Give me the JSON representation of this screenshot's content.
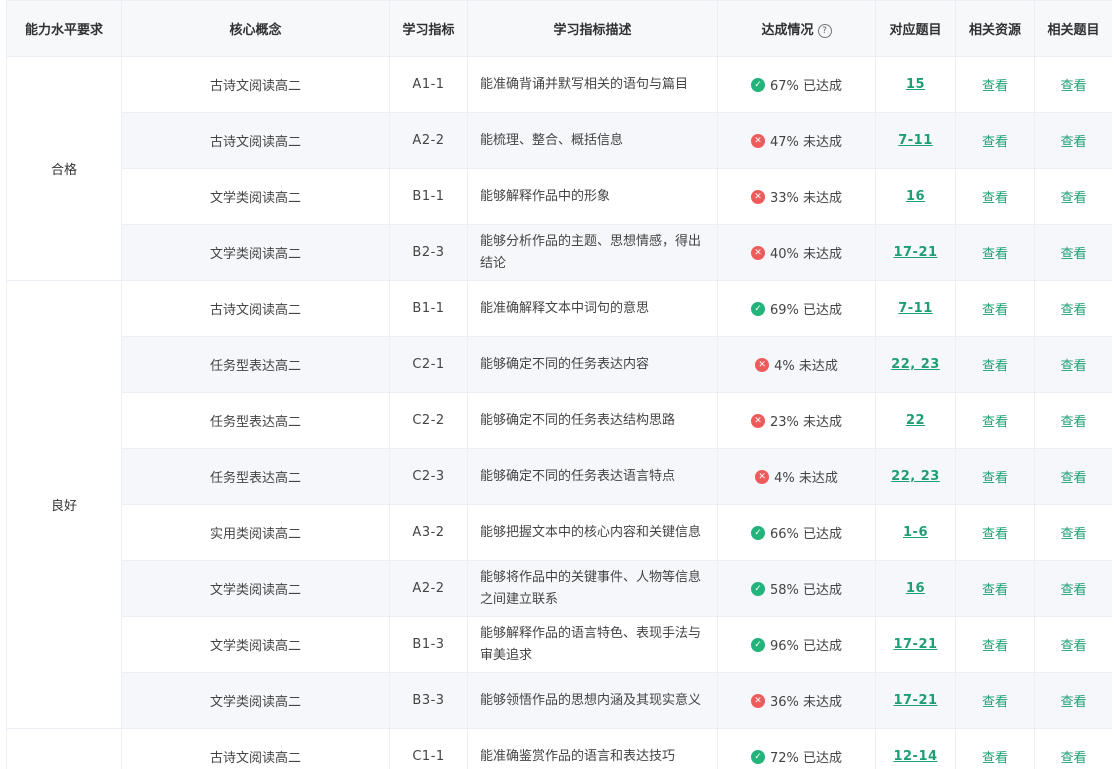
{
  "headers": {
    "level": "能力水平要求",
    "concept": "核心概念",
    "code": "学习指标",
    "desc": "学习指标描述",
    "status": "达成情况",
    "help_glyph": "?",
    "questions": "对应题目",
    "resources": "相关资源",
    "related": "相关题目"
  },
  "groups": [
    {
      "level": "合格"
    },
    {
      "level": "良好"
    },
    {
      "level": ""
    }
  ],
  "rows": [
    {
      "concept": "古诗文阅读高二",
      "code": "A1-1",
      "desc": "能准确背诵并默写相关的语句与篇目",
      "status": "67% 已达成",
      "ok": true,
      "questions": "15",
      "resources": "查看",
      "related": "查看"
    },
    {
      "concept": "古诗文阅读高二",
      "code": "A2-2",
      "desc": "能梳理、整合、概括信息",
      "status": "47% 未达成",
      "ok": false,
      "questions": "7-11",
      "resources": "查看",
      "related": "查看"
    },
    {
      "concept": "文学类阅读高二",
      "code": "B1-1",
      "desc": "能够解释作品中的形象",
      "status": "33% 未达成",
      "ok": false,
      "questions": "16",
      "resources": "查看",
      "related": "查看"
    },
    {
      "concept": "文学类阅读高二",
      "code": "B2-3",
      "desc": "能够分析作品的主题、思想情感，得出结论",
      "status": "40% 未达成",
      "ok": false,
      "questions": "17-21",
      "resources": "查看",
      "related": "查看"
    },
    {
      "concept": "古诗文阅读高二",
      "code": "B1-1",
      "desc": "能准确解释文本中词句的意思",
      "status": "69% 已达成",
      "ok": true,
      "questions": "7-11",
      "resources": "查看",
      "related": "查看"
    },
    {
      "concept": "任务型表达高二",
      "code": "C2-1",
      "desc": "能够确定不同的任务表达内容",
      "status": "4% 未达成",
      "ok": false,
      "questions": "22, 23",
      "resources": "查看",
      "related": "查看"
    },
    {
      "concept": "任务型表达高二",
      "code": "C2-2",
      "desc": "能够确定不同的任务表达结构思路",
      "status": "23% 未达成",
      "ok": false,
      "questions": "22",
      "resources": "查看",
      "related": "查看"
    },
    {
      "concept": "任务型表达高二",
      "code": "C2-3",
      "desc": "能够确定不同的任务表达语言特点",
      "status": "4% 未达成",
      "ok": false,
      "questions": "22, 23",
      "resources": "查看",
      "related": "查看"
    },
    {
      "concept": "实用类阅读高二",
      "code": "A3-2",
      "desc": "能够把握文本中的核心内容和关键信息",
      "status": "66% 已达成",
      "ok": true,
      "questions": "1-6",
      "resources": "查看",
      "related": "查看"
    },
    {
      "concept": "文学类阅读高二",
      "code": "A2-2",
      "desc": "能够将作品中的关键事件、人物等信息之间建立联系",
      "status": "58% 已达成",
      "ok": true,
      "questions": "16",
      "resources": "查看",
      "related": "查看"
    },
    {
      "concept": "文学类阅读高二",
      "code": "B1-3",
      "desc": "能够解释作品的语言特色、表现手法与审美追求",
      "status": "96% 已达成",
      "ok": true,
      "questions": "17-21",
      "resources": "查看",
      "related": "查看"
    },
    {
      "concept": "文学类阅读高二",
      "code": "B3-3",
      "desc": "能够领悟作品的思想内涵及其现实意义",
      "status": "36% 未达成",
      "ok": false,
      "questions": "17-21",
      "resources": "查看",
      "related": "查看"
    },
    {
      "concept": "古诗文阅读高二",
      "code": "C1-1",
      "desc": "能准确鉴赏作品的语言和表达技巧",
      "status": "72% 已达成",
      "ok": true,
      "questions": "12-14",
      "resources": "查看",
      "related": "查看"
    }
  ],
  "colors": {
    "ok": "#24b37a",
    "bad": "#ef5a5a",
    "link": "#1f9e73",
    "header_bg": "#f7f8fa",
    "stripe_bg": "#f6f7fb",
    "border": "#ebeef5"
  },
  "icons": {
    "ok": "check-circle-icon",
    "bad": "close-circle-icon",
    "help": "question-circle-icon"
  }
}
